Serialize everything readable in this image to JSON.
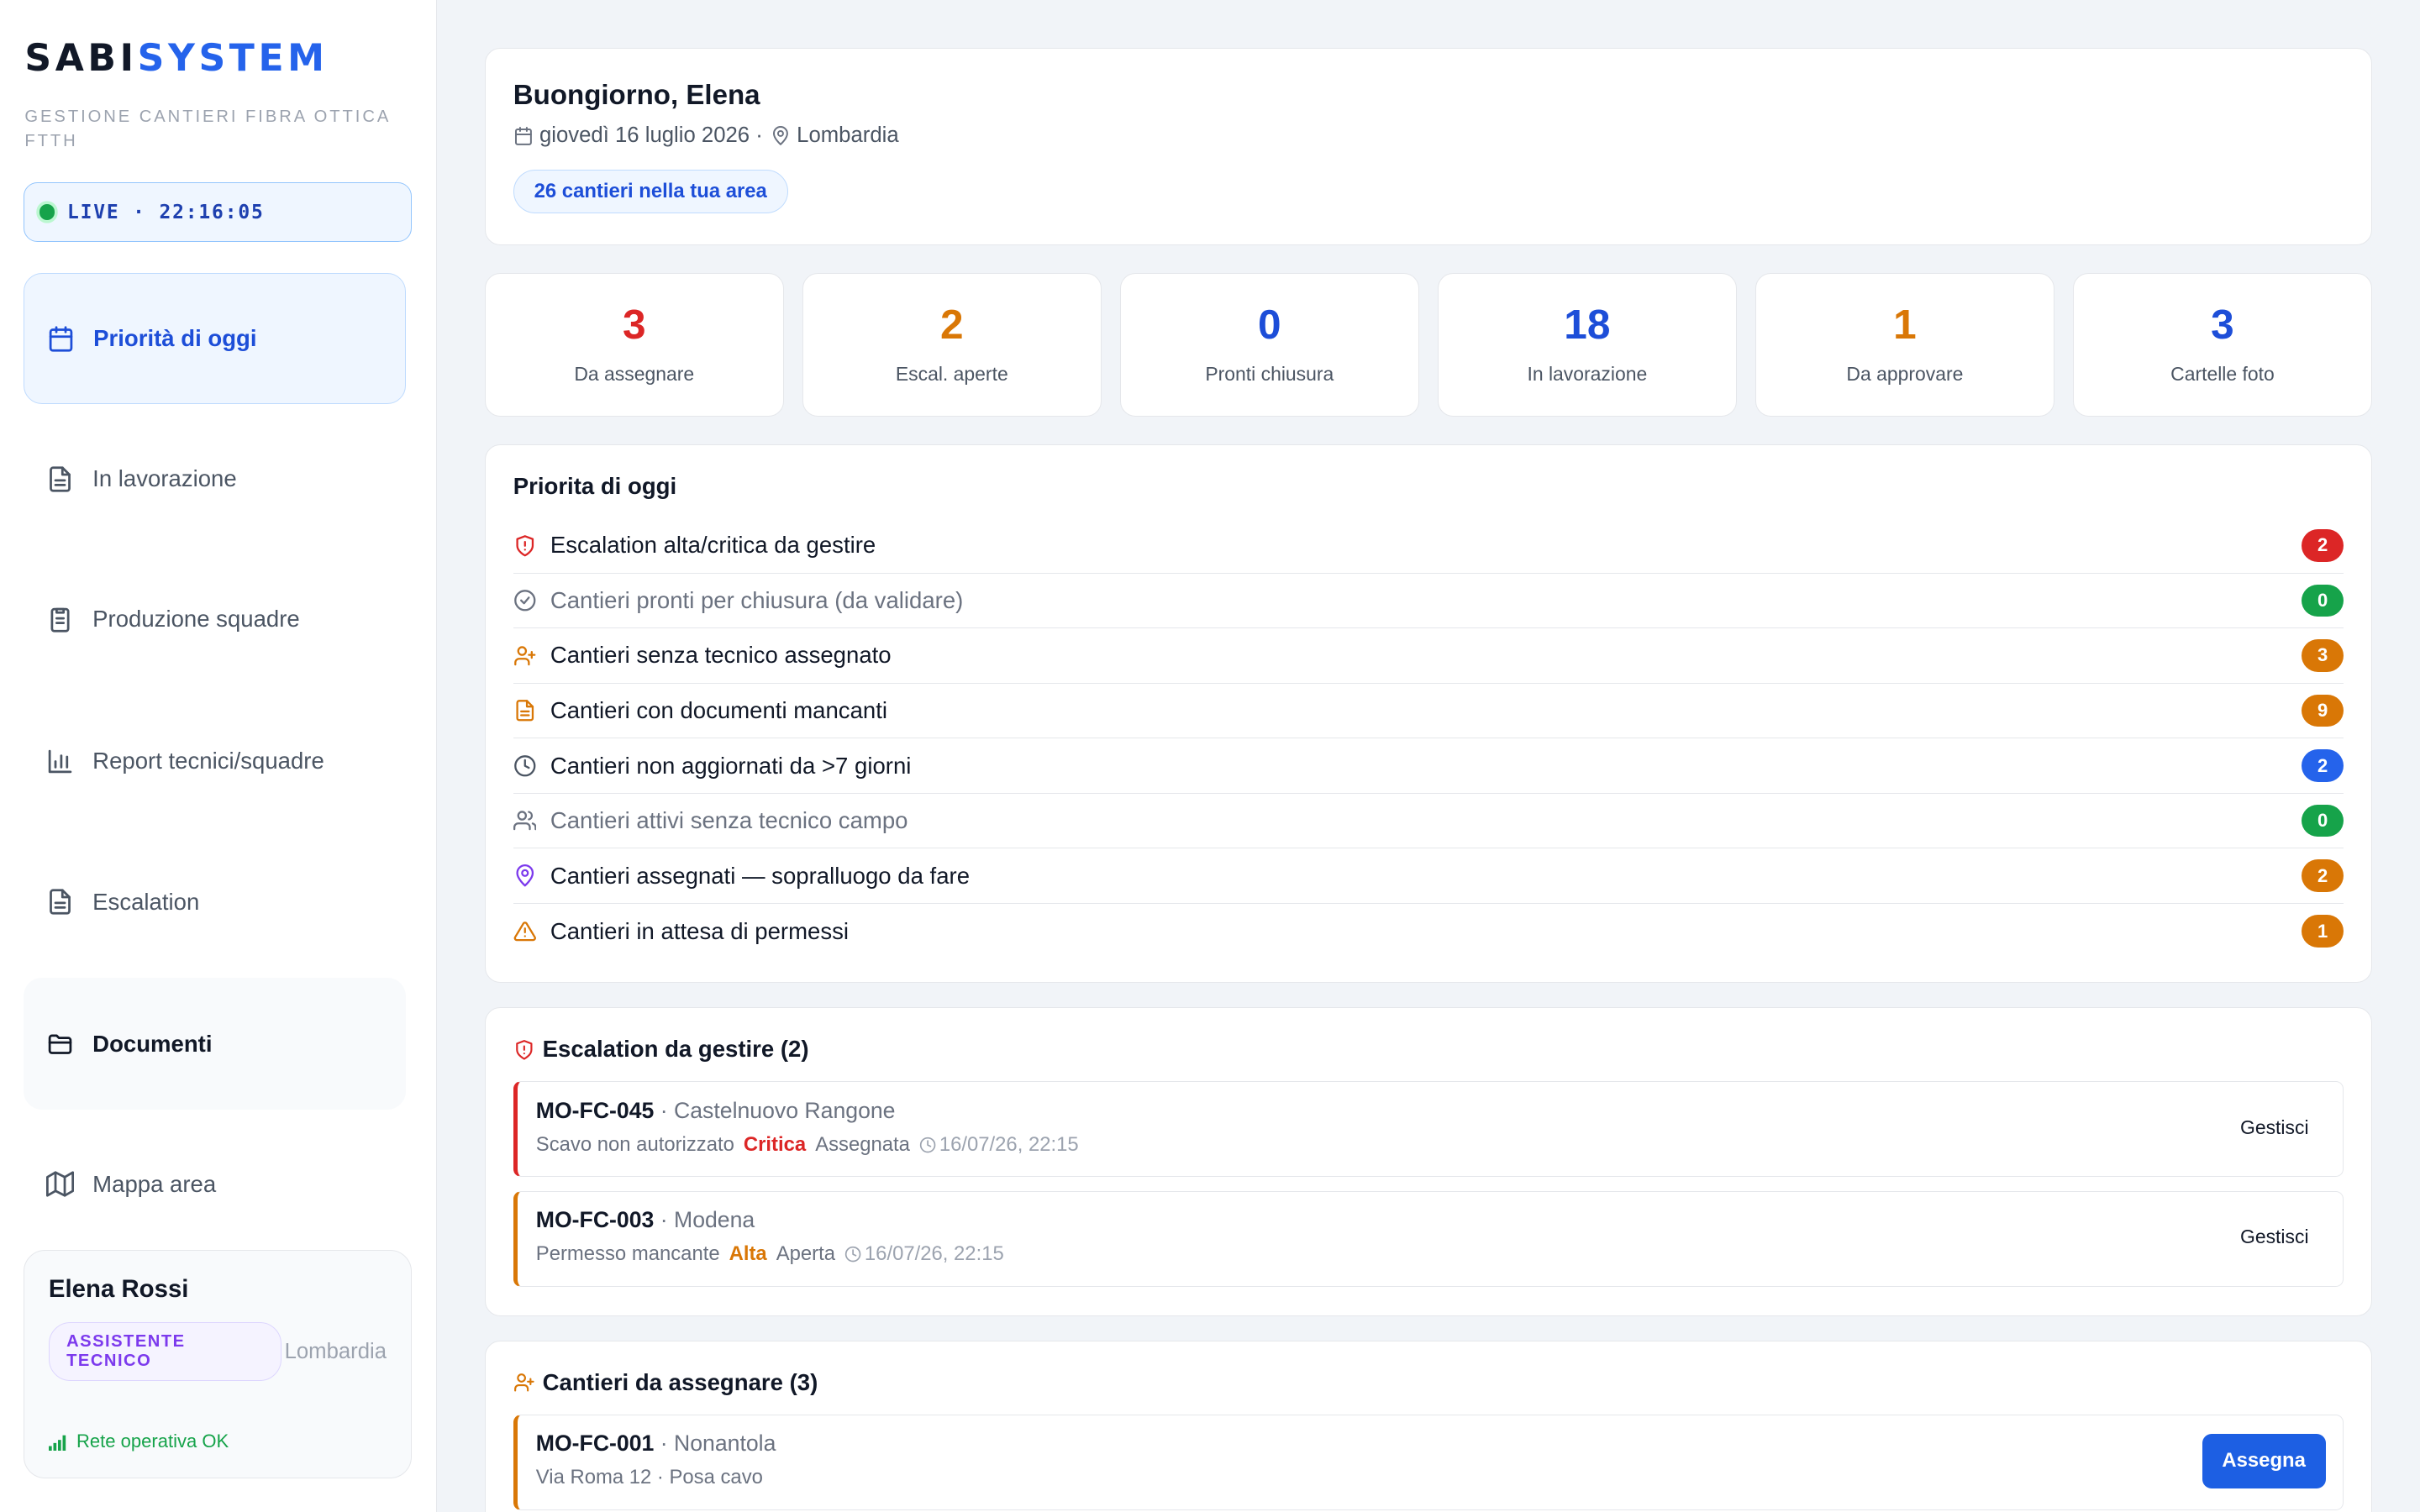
{
  "brand": {
    "part1": "SABI",
    "part2": "SYSTEM",
    "tagline": "GESTIONE CANTIERI FIBRA OTTICA FTTH"
  },
  "live": {
    "label": "LIVE · 22:16:05"
  },
  "nav": [
    {
      "label": "Priorità di oggi",
      "icon": "calendar-icon",
      "state": "active"
    },
    {
      "label": "In lavorazione",
      "icon": "file-icon"
    },
    {
      "label": "Produzione squadre",
      "icon": "clipboard-icon"
    },
    {
      "label": "Report tecnici/squadre",
      "icon": "bar-chart-icon"
    },
    {
      "label": "Escalation",
      "icon": "file-icon"
    },
    {
      "label": "Documenti",
      "icon": "folder-icon",
      "state": "hover"
    },
    {
      "label": "Mappa area",
      "icon": "map-icon"
    }
  ],
  "user": {
    "name": "Elena Rossi",
    "role": "ASSISTENTE TECNICO",
    "region": "Lombardia",
    "network": "Rete operativa OK"
  },
  "greeting": {
    "title": "Buongiorno, Elena",
    "date": "giovedì 16 luglio 2026 ·",
    "region": "Lombardia",
    "pill": "26 cantieri nella tua area"
  },
  "stats": [
    {
      "value": "3",
      "label": "Da assegnare",
      "color": "#dc2626"
    },
    {
      "value": "2",
      "label": "Escal. aperte",
      "color": "#d97706"
    },
    {
      "value": "0",
      "label": "Pronti chiusura",
      "color": "#1d4ed8"
    },
    {
      "value": "18",
      "label": "In lavorazione",
      "color": "#1d4ed8"
    },
    {
      "value": "1",
      "label": "Da approvare",
      "color": "#d97706"
    },
    {
      "value": "3",
      "label": "Cartelle foto",
      "color": "#1d4ed8"
    }
  ],
  "priorities": {
    "title": "Priorita di oggi",
    "items": [
      {
        "label": "Escalation alta/critica da gestire",
        "count": "2",
        "icon": "shield-alert-icon",
        "icon_color": "#dc2626",
        "badge_color": "#dc2626",
        "muted": false
      },
      {
        "label": "Cantieri pronti per chiusura (da validare)",
        "count": "0",
        "icon": "check-circle-icon",
        "icon_color": "#6b7280",
        "badge_color": "#16a34a",
        "muted": true
      },
      {
        "label": "Cantieri senza tecnico assegnato",
        "count": "3",
        "icon": "user-plus-icon",
        "icon_color": "#d97706",
        "badge_color": "#d97706",
        "muted": false
      },
      {
        "label": "Cantieri con documenti mancanti",
        "count": "9",
        "icon": "document-icon",
        "icon_color": "#d97706",
        "badge_color": "#d97706",
        "muted": false
      },
      {
        "label": "Cantieri non aggiornati da >7 giorni",
        "count": "2",
        "icon": "clock-icon",
        "icon_color": "#4b5563",
        "badge_color": "#2563eb",
        "muted": false
      },
      {
        "label": "Cantieri attivi senza tecnico campo",
        "count": "0",
        "icon": "users-icon",
        "icon_color": "#6b7280",
        "badge_color": "#16a34a",
        "muted": true
      },
      {
        "label": "Cantieri assegnati — sopralluogo da fare",
        "count": "2",
        "icon": "map-pin-icon",
        "icon_color": "#7c3aed",
        "badge_color": "#d97706",
        "muted": false
      },
      {
        "label": "Cantieri in attesa di permessi",
        "count": "1",
        "icon": "warning-icon",
        "icon_color": "#d97706",
        "badge_color": "#d97706",
        "muted": false
      }
    ]
  },
  "escalations": {
    "title": "Escalation da gestire (2)",
    "action_label": "Gestisci",
    "items": [
      {
        "code": "MO-FC-045",
        "location": "· Castelnuovo Rangone",
        "reason": "Scavo non autorizzato",
        "severity": "Critica",
        "severity_color": "#dc2626",
        "status": "Assegnata",
        "time": "16/07/26, 22:15",
        "border_color": "#dc2626"
      },
      {
        "code": "MO-FC-003",
        "location": "· Modena",
        "reason": "Permesso mancante",
        "severity": "Alta",
        "severity_color": "#d97706",
        "status": "Aperta",
        "time": "16/07/26, 22:15",
        "border_color": "#d97706"
      }
    ]
  },
  "to_assign": {
    "title": "Cantieri da assegnare (3)",
    "items": [
      {
        "code": "MO-FC-001",
        "location": "· Nonantola",
        "detail": "Via Roma 12 · Posa cavo",
        "action": "Assegna"
      }
    ]
  }
}
